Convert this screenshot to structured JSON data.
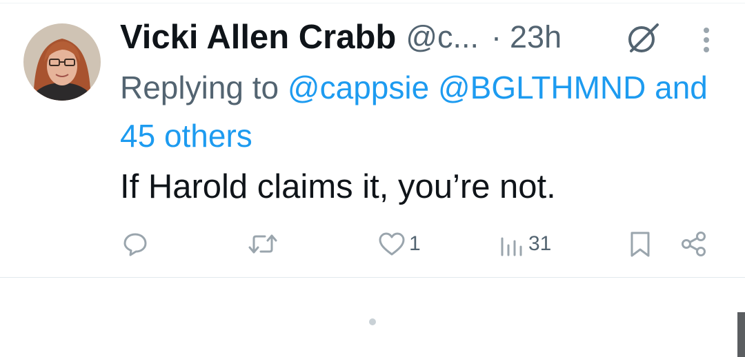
{
  "tweet": {
    "author": {
      "display_name": "Vicki Allen Crabb",
      "handle": "@c...",
      "avatar": "avatar"
    },
    "separator": "·",
    "time": "23h",
    "reply": {
      "prefix": "Replying to",
      "mentions": [
        "@cappsie",
        "@BGLTHMND"
      ],
      "connector": "and",
      "others": "45 others"
    },
    "text": "If Harold claims it, you’re not.",
    "actions": {
      "reply": {
        "icon": "reply-icon",
        "count": ""
      },
      "repost": {
        "icon": "repost-icon",
        "count": ""
      },
      "like": {
        "icon": "heart-icon",
        "count": "1"
      },
      "views": {
        "icon": "views-icon",
        "count": "31"
      },
      "bookmark": {
        "icon": "bookmark-icon"
      },
      "share": {
        "icon": "share-icon"
      }
    }
  },
  "colors": {
    "text": "#0f1419",
    "secondary": "#536471",
    "link": "#1d9bf0",
    "icon": "#9aa5ad",
    "divider": "#e1e8ed"
  }
}
